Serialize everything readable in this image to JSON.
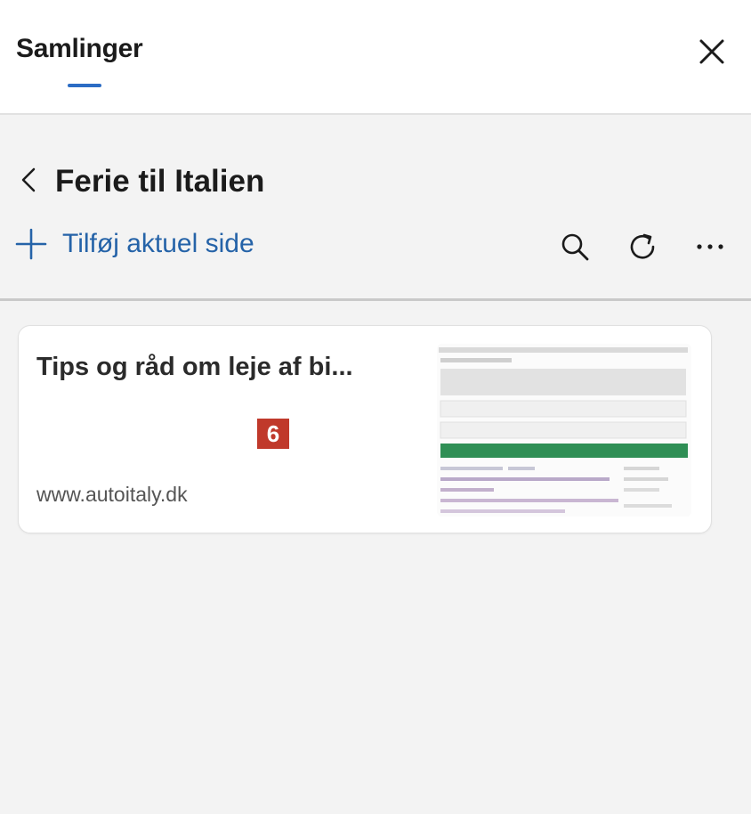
{
  "header": {
    "tab_label": "Samlinger",
    "close_icon": "close-icon",
    "accent_color": "#2b6cc4"
  },
  "collection": {
    "title": "Ferie til Italien",
    "back_icon": "chevron-left-icon",
    "add_label": "Tilføj aktuel side",
    "add_icon": "plus-icon",
    "tools": [
      "search-icon",
      "refresh-icon",
      "more-icon"
    ]
  },
  "items": [
    {
      "title": "Tips og råd om leje af bi...",
      "url": "www.autoitaly.dk",
      "badge": "6"
    }
  ]
}
